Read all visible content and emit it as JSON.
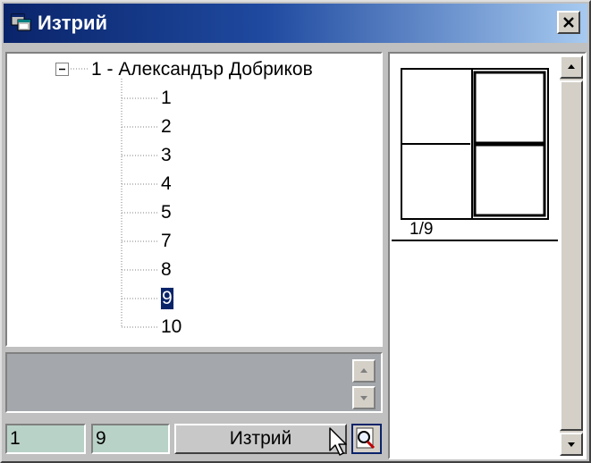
{
  "window": {
    "title": "Изтрий",
    "close_icon": "close-icon",
    "app_icon": "app-window-icon"
  },
  "tree": {
    "root_label": "1 - Александър Добриков",
    "expander_state": "expanded",
    "items": [
      {
        "label": "1"
      },
      {
        "label": "2"
      },
      {
        "label": "3"
      },
      {
        "label": "4"
      },
      {
        "label": "5"
      },
      {
        "label": "7"
      },
      {
        "label": "8"
      },
      {
        "label": "9"
      },
      {
        "label": "10"
      }
    ],
    "selected_label": "9"
  },
  "memo": {
    "value": ""
  },
  "bottom_bar": {
    "field_1": "1",
    "field_2": "9",
    "delete_label": "Изтрий",
    "zoom_icon": "magnifier-icon"
  },
  "preview": {
    "page_label": "1/9"
  },
  "colors": {
    "title_gradient_start": "#0a246a",
    "title_gradient_end": "#a6caf0",
    "selection": "#0a246a",
    "field_bg": "#b9d2c8",
    "memo_bg": "#a4a8ac",
    "face": "#c0c0c0"
  }
}
